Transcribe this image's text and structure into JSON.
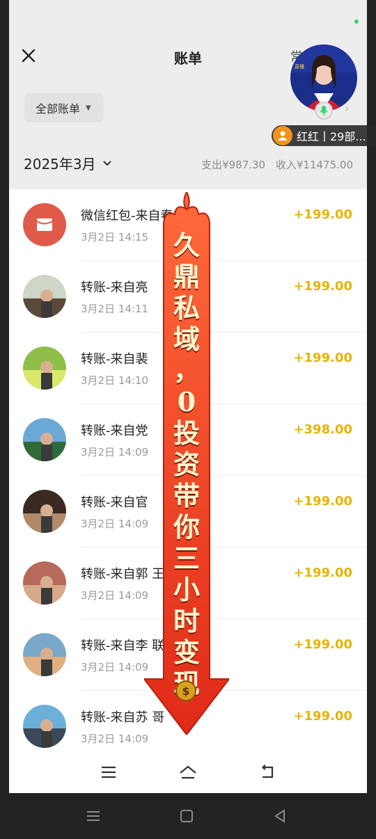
{
  "app": {
    "title": "账单",
    "partial_header_text": "常见问题"
  },
  "filter": {
    "label": "全部账单"
  },
  "summary": {
    "month": "2025年3月",
    "expense": "支出¥987.30",
    "income": "收入¥11475.00"
  },
  "transactions": [
    {
      "name": "微信红包-来自春艳",
      "time": "3月2日 14:15",
      "amount": "+199.00",
      "avatar": "red-packet-icon"
    },
    {
      "name": "转账-来自亮",
      "time": "3月2日 14:11",
      "amount": "+199.00",
      "avatar": "user-photo"
    },
    {
      "name": "转账-来自裴",
      "time": "3月2日 14:10",
      "amount": "+199.00",
      "avatar": "user-photo"
    },
    {
      "name": "转账-来自党",
      "time": "3月2日 14:09",
      "amount": "+398.00",
      "avatar": "user-photo"
    },
    {
      "name": "转账-来自官",
      "time": "3月2日 14:09",
      "amount": "+199.00",
      "avatar": "user-photo"
    },
    {
      "name": "转账-来自郭    王旭照",
      "time": "3月2日 14:09",
      "amount": "+199.00",
      "avatar": "user-photo"
    },
    {
      "name": "转账-来自李    联",
      "time": "3月2日 14:09",
      "amount": "+199.00",
      "avatar": "user-photo"
    },
    {
      "name": "转账-来自苏    哥",
      "time": "3月2日 14:09",
      "amount": "+199.00",
      "avatar": "user-photo"
    }
  ],
  "live_overlay": {
    "streamer_label": "红红丨29部...",
    "card_text": "直播"
  },
  "promo": {
    "characters": [
      "久",
      "鼎",
      "私",
      "域",
      "，",
      "0",
      "投",
      "资",
      "带",
      "你",
      "三",
      "小",
      "时",
      "变",
      "现"
    ]
  },
  "icons": {
    "close": "close-icon",
    "menu": "menu-icon",
    "home": "home-icon",
    "back": "back-icon",
    "mic": "mic-icon",
    "user": "user-icon"
  },
  "colors": {
    "amount": "#e6b400",
    "red_packet": "#e05a4a",
    "promo_red": "#e8452c",
    "header_bg": "#ededed"
  }
}
